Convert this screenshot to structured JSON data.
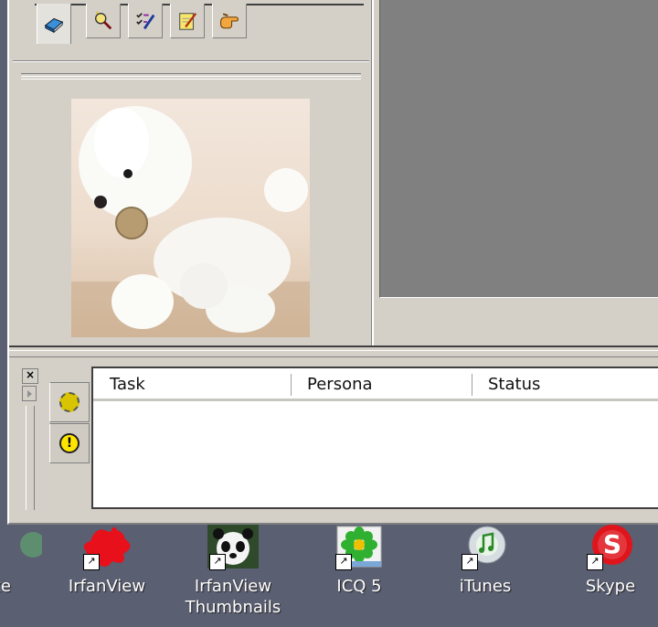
{
  "toolbar_tabs": [
    {
      "icon": "book-icon",
      "active": true
    },
    {
      "icon": "magic-search-icon",
      "active": false
    },
    {
      "icon": "checklist-edit-icon",
      "active": false
    },
    {
      "icon": "notepad-edit-icon",
      "active": false
    },
    {
      "icon": "hand-pointing-icon",
      "active": false
    }
  ],
  "task_panel": {
    "close_glyph": "×",
    "columns": [
      "Task",
      "Persona",
      "Status"
    ],
    "side_tabs": [
      {
        "icon": "gear-icon"
      },
      {
        "icon": "alert-icon",
        "glyph": "!"
      }
    ]
  },
  "desktop": {
    "items": [
      {
        "label": "exe",
        "icon": "app-icon"
      },
      {
        "label": "IrfanView",
        "icon": "irfanview-icon"
      },
      {
        "label": "IrfanView\nThumbnails",
        "icon": "irfanview-thumbnails-icon"
      },
      {
        "label": "ICQ 5",
        "icon": "icq-flower-icon"
      },
      {
        "label": "iTunes",
        "icon": "itunes-icon"
      },
      {
        "label": "Skype",
        "icon": "skype-icon"
      }
    ],
    "shortcut_glyph": "↗"
  },
  "colors": {
    "desktop_bg": "#5a5f72",
    "window_bg": "#d4d0c8",
    "preview_bg": "#808080"
  }
}
